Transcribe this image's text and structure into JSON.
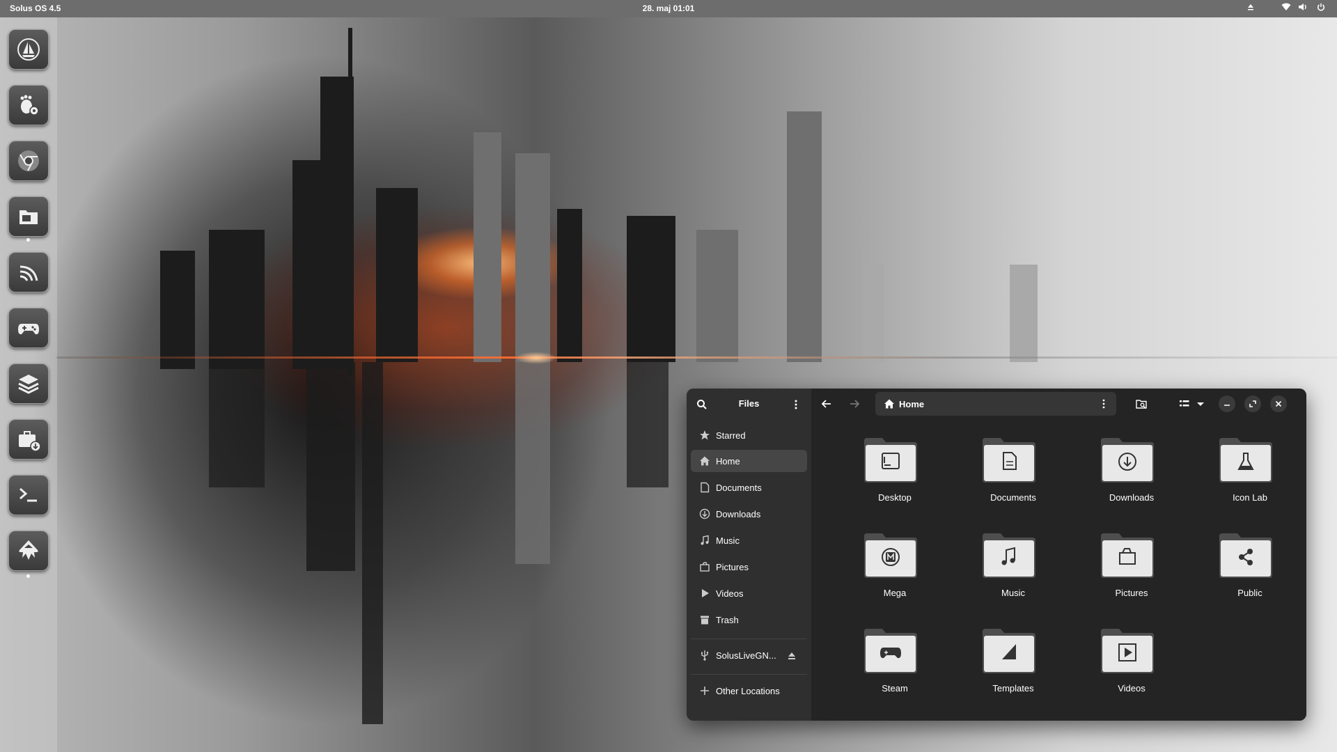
{
  "topbar": {
    "os_label": "Solus OS 4.5",
    "clock": "28. maj  01:01",
    "tray_icons": [
      "eject-icon",
      "wifi-icon",
      "volume-icon",
      "power-icon"
    ]
  },
  "dock": {
    "items": [
      {
        "name": "solus-icon"
      },
      {
        "name": "gnome-settings-icon"
      },
      {
        "name": "chrome-icon"
      },
      {
        "name": "files-icon",
        "running": true
      },
      {
        "name": "rss-feed-icon"
      },
      {
        "name": "gamepad-icon"
      },
      {
        "name": "layers-icon"
      },
      {
        "name": "software-installer-icon"
      },
      {
        "name": "terminal-icon"
      },
      {
        "name": "inkscape-icon",
        "running": true
      }
    ]
  },
  "files_window": {
    "sidebar_title": "Files",
    "places": [
      {
        "label": "Starred",
        "icon": "star-icon"
      },
      {
        "label": "Home",
        "icon": "home-icon",
        "selected": true
      },
      {
        "label": "Documents",
        "icon": "document-icon"
      },
      {
        "label": "Downloads",
        "icon": "download-icon"
      },
      {
        "label": "Music",
        "icon": "music-icon"
      },
      {
        "label": "Pictures",
        "icon": "picture-icon"
      },
      {
        "label": "Videos",
        "icon": "video-icon"
      },
      {
        "label": "Trash",
        "icon": "trash-icon"
      }
    ],
    "device": {
      "label": "SolusLiveGN...",
      "icon": "usb-icon"
    },
    "other_locations": "Other Locations",
    "path_label": "Home",
    "folders": [
      {
        "label": "Desktop",
        "emblem": "desktop"
      },
      {
        "label": "Documents",
        "emblem": "document"
      },
      {
        "label": "Downloads",
        "emblem": "download"
      },
      {
        "label": "Icon Lab",
        "emblem": "flask"
      },
      {
        "label": "Mega",
        "emblem": "mega"
      },
      {
        "label": "Music",
        "emblem": "music"
      },
      {
        "label": "Pictures",
        "emblem": "picture"
      },
      {
        "label": "Public",
        "emblem": "share"
      },
      {
        "label": "Steam",
        "emblem": "gamepad"
      },
      {
        "label": "Templates",
        "emblem": "template"
      },
      {
        "label": "Videos",
        "emblem": "video"
      }
    ]
  },
  "colors": {
    "window_bg": "#242424",
    "sidebar_bg": "#2f2f2f",
    "selected_bg": "#464646",
    "accent_orange": "#ff7a2a"
  }
}
